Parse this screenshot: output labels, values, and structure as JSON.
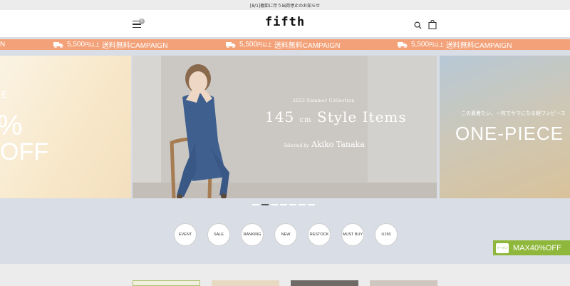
{
  "notice": {
    "text": "[8/1]棚卸に伴う出荷停止のお知らせ"
  },
  "header": {
    "logo": "fifth",
    "menu_badge": "0"
  },
  "campaign": {
    "items": [
      {
        "amount": "5,500",
        "unit": "円以上",
        "text": "送料無料CAMPAIGN"
      },
      {
        "amount": "5,500",
        "unit": "円以上",
        "text": "送料無料CAMPAIGN"
      },
      {
        "amount": "5,500",
        "unit": "円以上",
        "text": "送料無料CAMPAIGN"
      }
    ],
    "lead_fragment": "N"
  },
  "slides": {
    "left": {
      "line1": "%",
      "line2": "OFF",
      "fragment": "E"
    },
    "main": {
      "subtitle": "2023 Summer Collection",
      "title_num": "145",
      "title_unit": "cm",
      "title_text": "Style Items",
      "selected_label": "Selected by",
      "selected_name": "Akiko Tanaka"
    },
    "right": {
      "jp": "この夏着たい、一枚でサマになる軽ワンピース",
      "title": "ONE-PIECE"
    }
  },
  "categories": [
    "EVENT",
    "SALE",
    "RANKING",
    "NEW",
    "RESTOCK",
    "MUST BUY",
    "U150"
  ],
  "coupon": {
    "tag": "クーポン",
    "text": "MAX40%OFF"
  },
  "colors": {
    "campaign": "#f3a178",
    "coupon": "#8fb73b",
    "page_bg": "#d9dde5"
  }
}
